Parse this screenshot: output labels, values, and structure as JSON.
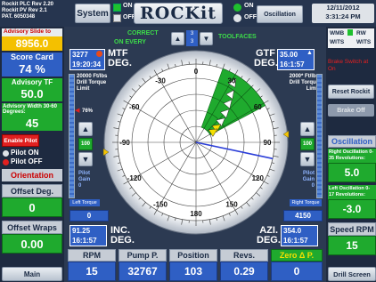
{
  "header": {
    "plc": [
      "Rockit PLC Rev 2.20",
      "Rockit PV Rev 2.1",
      "PAT. 6050348"
    ],
    "system": "System",
    "on": "ON",
    "off": "OFF",
    "logo": "ROCKit",
    "correct": "CORRECT",
    "on_every": "ON EVERY",
    "every_count": "3",
    "every_count2": "3",
    "toolfaces": "TOOLFACES",
    "sw_on": "ON",
    "sw_off": "OFF",
    "oscillation": "Oscillation",
    "date": "12/11/2012",
    "time": "3:31:24 PM",
    "wmb": "WMB",
    "wits": "WITS",
    "rw": "RW",
    "wits2": "WITS"
  },
  "left": {
    "adv_slide_lbl": "Advisory Slide to",
    "adv_slide_val": "8956.0",
    "score_lbl": "Score Card",
    "score_val": "74 %",
    "adv_tf_lbl": "Advisory TF",
    "adv_tf_val": "50.0",
    "adv_width_lbl": "Advisory Width 30-60 Degrees:",
    "adv_width_val": "45",
    "enable_pilot": "Enable Pilot",
    "pilot_on": "Pilot ON",
    "pilot_off": "Pilot OFF",
    "orientation": "Orientation",
    "offset_deg_lbl": "Offset Deg.",
    "offset_deg_val": "0",
    "offset_wraps_lbl": "Offset Wraps",
    "offset_wraps_val": "0.00",
    "main": "Main"
  },
  "center": {
    "mtf_val": "3277",
    "mtf_time": "19:20:34",
    "mtf_lbl": "MTF",
    "mtf_deg": "DEG.",
    "gtf_val": "35.00",
    "gtf_time": "16:1:57",
    "gtf_lbl": "GTF",
    "gtf_deg": "DEG.",
    "tq_left": "20000 Ft/lbs",
    "drill_tq": "Drill Torque",
    "limit": "Limit",
    "tq_right": "2000* Ft/lbs",
    "drill_tq_r": "Drill Torque",
    "limit_r": "Limit",
    "pct_l": "76%",
    "gain_l": "100",
    "gain_r": "100",
    "pilot_gain": "Pilot",
    "gain_word": "Gain",
    "gain_zero": "0",
    "left_torque": "Left Torque",
    "right_torque": "Right Torque",
    "left_tq_val": "0",
    "right_tq_val": "4150",
    "inc_val": "91.25",
    "inc_time": "16:1:57",
    "inc_lbl": "INC.",
    "inc_deg": "DEG.",
    "azi_val": "354.0",
    "azi_time": "16:1:57",
    "azi_lbl": "AZI.",
    "azi_deg": "DEG.",
    "ticks": [
      "0",
      "30",
      "60",
      "90",
      "120",
      "150",
      "180",
      "-150",
      "-120",
      "-90",
      "-60",
      "-30"
    ]
  },
  "bottom": {
    "rpm_lbl": "RPM",
    "rpm_val": "15",
    "pump_lbl": "Pump P.",
    "pump_val": "32767",
    "pos_lbl": "Position",
    "pos_val": "103",
    "revs_lbl": "Revs.",
    "revs_val": "0.29",
    "zero_lbl": "Zero Δ P.",
    "zero_val": "0"
  },
  "right": {
    "brake_msg": "Brake Switch at On",
    "reset": "Reset Rockit",
    "brake_off": "Brake Off",
    "osc_head": "Oscillation",
    "right_osc_lbl": "Right Oscillation 0-35 Revolutions:",
    "right_osc_val": "5.0",
    "left_osc_lbl": "Left Oscillation 0-17 Revolutions:",
    "left_osc_val": "-3.0",
    "speed_lbl": "Speed RPM",
    "speed_val": "15",
    "drill_screen": "Drill Screen"
  },
  "colors": {
    "green": "#1faa2e",
    "blue": "#2f5fc4",
    "gold": "#f5c400"
  }
}
